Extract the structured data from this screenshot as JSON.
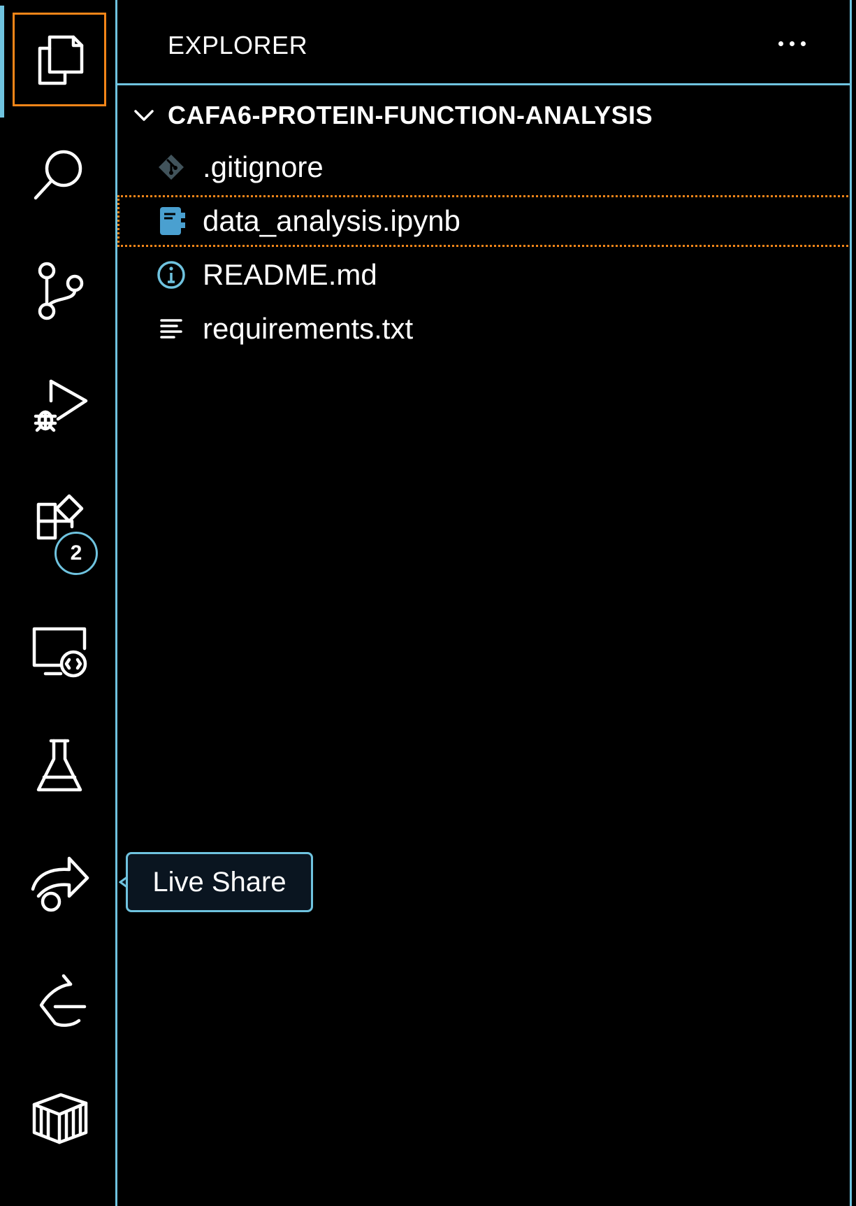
{
  "activity_bar": {
    "items": [
      {
        "id": "explorer",
        "icon": "files-icon",
        "active": true
      },
      {
        "id": "search",
        "icon": "search-icon"
      },
      {
        "id": "source-control",
        "icon": "source-control-icon"
      },
      {
        "id": "run-debug",
        "icon": "run-debug-icon"
      },
      {
        "id": "extensions",
        "icon": "extensions-icon",
        "badge": "2"
      },
      {
        "id": "remote-explorer",
        "icon": "remote-explorer-icon"
      },
      {
        "id": "testing",
        "icon": "flask-icon"
      },
      {
        "id": "live-share",
        "icon": "live-share-icon"
      },
      {
        "id": "copilot",
        "icon": "copilot-icon"
      },
      {
        "id": "containers",
        "icon": "container-icon"
      }
    ],
    "extensions_badge": "2"
  },
  "sidebar": {
    "title": "EXPLORER",
    "folder": {
      "name": "CAFA6-PROTEIN-FUNCTION-ANALYSIS",
      "expanded": true
    },
    "files": [
      {
        "name": ".gitignore",
        "icon": "git-file-icon"
      },
      {
        "name": "data_analysis.ipynb",
        "icon": "notebook-icon",
        "focused": true
      },
      {
        "name": "README.md",
        "icon": "info-icon"
      },
      {
        "name": "requirements.txt",
        "icon": "text-lines-icon"
      }
    ]
  },
  "tooltip": {
    "text": "Live Share"
  },
  "colors": {
    "accent_border": "#6fc3df",
    "focus_border": "#f38518",
    "notebook_icon": "#4aa0d0",
    "git_icon": "#41535b",
    "background": "#000000"
  }
}
